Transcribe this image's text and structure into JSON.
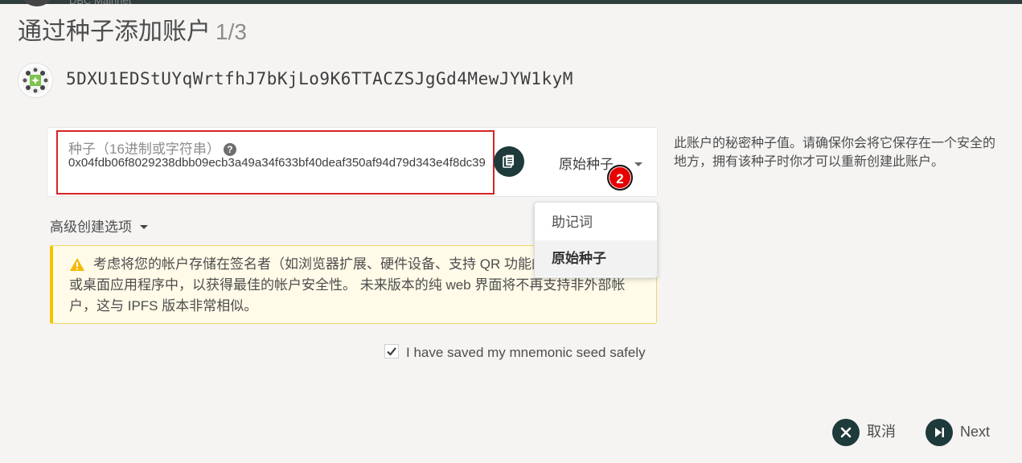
{
  "topbar": {
    "network_label": "DBC Mainnet"
  },
  "modal": {
    "title": "通过种子添加账户",
    "step": "1/3"
  },
  "account": {
    "address": "5DXU1EDStUYqWrtfhJ7bKjLo9K6TTACZSJgGd4MewJYW1kyM",
    "identicon_icon": "identicon"
  },
  "seed": {
    "label": "种子（16进制或字符串）",
    "help_icon": "question-circle-icon",
    "value": "0x04fdb06f8029238dbb09ecb3a49a34f633bf40deaf350af94d79d343e4f8dc39",
    "copy_icon": "copy-icon",
    "type_selected": "原始种子",
    "help_text": "此账户的秘密种子值。请确保你会将它保存在一个安全的地方，拥有该种子时你才可以重新创建此账户。"
  },
  "annotation_badge": "2",
  "type_dropdown": {
    "options": [
      {
        "label": "助记词",
        "selected": false
      },
      {
        "label": "原始种子",
        "selected": true
      }
    ]
  },
  "advanced": {
    "label": "高级创建选项"
  },
  "warning": {
    "icon": "warning-triangle-icon",
    "text": "考虑将您的帐户存储在签名者（如浏览器扩展、硬件设备、支持 QR 功能的移动设备连接）或桌面应用程序中，以获得最佳的帐户安全性。 未来版本的纯 web 界面将不再支持非外部帐户，这与 IPFS 版本非常相似。",
    "colors": {
      "border": "#f5c400",
      "background": "#fffbe8"
    }
  },
  "confirm": {
    "label": "I have saved my mnemonic seed safely",
    "checked": true
  },
  "actions": {
    "cancel_label": "取消",
    "next_label": "Next"
  },
  "colors": {
    "accent": "#1e3a3a",
    "highlight_border": "#d42525",
    "badge": "#e60000"
  }
}
